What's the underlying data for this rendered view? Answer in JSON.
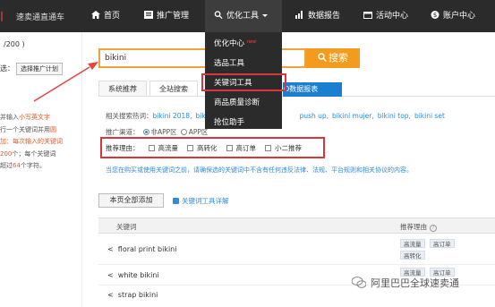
{
  "brand": {
    "logo_mark": "|",
    "name": "速卖通直通车"
  },
  "nav": {
    "items": [
      {
        "label": "首页",
        "icon": "home-icon"
      },
      {
        "label": "推广管理",
        "icon": "promotion-icon"
      },
      {
        "label": "优化工具",
        "icon": "search-icon"
      },
      {
        "label": "数据报告",
        "icon": "chart-icon"
      },
      {
        "label": "活动中心",
        "icon": "calendar-icon"
      },
      {
        "label": "账户中心",
        "icon": "dollar-icon"
      }
    ]
  },
  "dropdown": {
    "items": [
      "优化中心",
      "选品工具",
      "关键词工具",
      "商品质量诊断",
      "抢位助手"
    ],
    "new_badge": "new",
    "extra_tab": "O数据报表"
  },
  "left_panel": {
    "count": "/200 )",
    "select_prefix": "选：",
    "select_button": "选择推广计划",
    "tips": [
      {
        "parts": [
          "并输入",
          "小写英文字"
        ],
        "red": [
          false,
          true
        ]
      },
      {
        "parts": [
          "行一个关键词并用",
          "圆"
        ],
        "red": [
          false,
          true
        ]
      },
      {
        "parts": [
          "",
          "加：每次输入的关键词"
        ],
        "red": [
          false,
          true
        ]
      },
      {
        "parts": [
          "200",
          "个；每个关键词"
        ],
        "red": [
          true,
          false
        ]
      },
      {
        "parts": [
          "超过",
          "64",
          "个字符。"
        ],
        "red": [
          false,
          true,
          false
        ]
      }
    ]
  },
  "search": {
    "value": "bikini",
    "button": "搜索"
  },
  "tabs": [
    "系统推荐",
    "全站搜索"
  ],
  "related": {
    "label": "相关搜索热词：",
    "keywords": [
      "bikini 2018,",
      "bikini",
      "push up,",
      "bikini mujer,",
      "bikini top,",
      "bikini set"
    ]
  },
  "channel": {
    "label": "推广渠道：",
    "options": [
      "非APP区",
      "APP区"
    ]
  },
  "reason": {
    "label": "推荐理由：",
    "options": [
      "高流量",
      "高转化",
      "高订单",
      "小二推荐"
    ]
  },
  "notice": "当您在购买或使用关键词之前，请确保选的关键词中不含有任何违反法律、法规、平台规则和相关协议的内容。",
  "actions": {
    "add_all": "本页全部添加",
    "detail": "关键词工具详解"
  },
  "table": {
    "headers": {
      "keyword": "关键词",
      "reason": "推荐理由"
    },
    "rows": [
      {
        "keyword": "floral print bikini",
        "tags": [
          "高流量",
          "高订单",
          "高转化"
        ]
      },
      {
        "keyword": "white bikini",
        "tags": [
          "高流量",
          "高订单"
        ]
      },
      {
        "keyword": "strap bikini",
        "tags": []
      }
    ]
  },
  "watermark": "阿里巴巴全球速卖通",
  "colors": {
    "nav_bg": "#2b2b2b",
    "accent_orange": "#f39b1d",
    "link_blue": "#2d8cdb",
    "highlight_red": "#d9353a"
  }
}
